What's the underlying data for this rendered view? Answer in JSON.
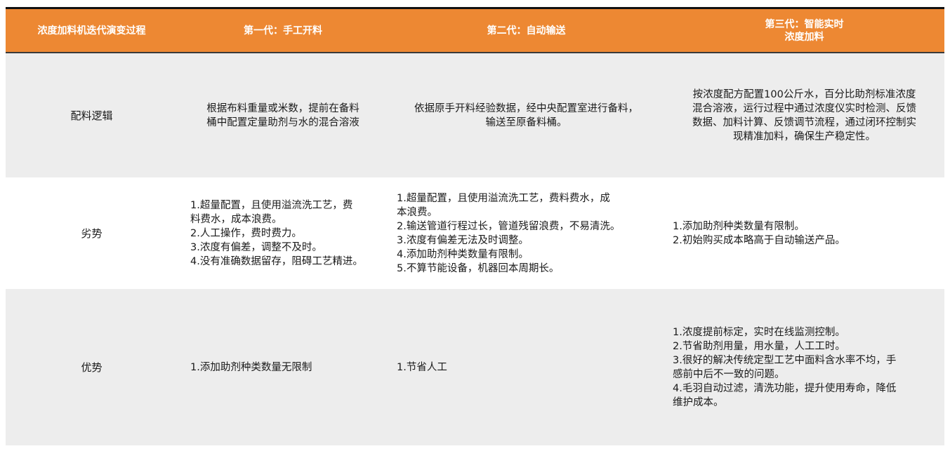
{
  "header": {
    "col0": "浓度加料机迭代演变过程",
    "col1": "第一代：手工开料",
    "col2": "第二代：自动输送",
    "col3": "第三代：智能实时\n浓度加料"
  },
  "rows": [
    {
      "label": "配料逻辑",
      "gen1": "根据布料重量或米数，提前在备料\n桶中配置定量助剂与水的混合溶液",
      "gen2": "依据原手开料经验数据，经中央配置室进行备料，\n输送至原备料桶。",
      "gen3": "按浓度配方配置100公斤水，百分比助剂标准浓度\n混合溶液，运行过程中通过浓度仪实时检测、反馈\n数据、加料计算、反馈调节流程，通过闭环控制实\n现精准加料，确保生产稳定性。"
    },
    {
      "label": "劣势",
      "gen1": "1.超量配置，且使用溢流洗工艺，费\n料费水，成本浪费。\n2.人工操作，费时费力。\n3.浓度有偏差，调整不及时。\n4.没有准确数据留存，阻碍工艺精进。",
      "gen2": "1.超量配置，且使用溢流洗工艺，费料费水，成\n本浪费。\n2.输送管道行程过长，管道残留浪费，不易清洗。\n3.浓度有偏差无法及时调整。\n4.添加助剂种类数量有限制。\n5.不算节能设备，机器回本周期长。",
      "gen3": "1.添加助剂种类数量有限制。\n2.初始购买成本略高于自动输送产品。"
    },
    {
      "label": "优势",
      "gen1": "1.添加助剂种类数量无限制",
      "gen2": "1.节省人工",
      "gen3": "1.浓度提前标定，实时在线监测控制。\n2.节省助剂用量，用水量，人工工时。\n3.很好的解决传统定型工艺中面料含水率不均，手\n感前中后不一致的问题。\n4.毛羽自动过滤，清洗功能，提升使用寿命，降低\n维护成本。"
    }
  ],
  "colors": {
    "header_bg": "#ED8833",
    "header_text": "#FFFFFF",
    "row_shade": "#EDEDED",
    "rule": "#111111"
  }
}
